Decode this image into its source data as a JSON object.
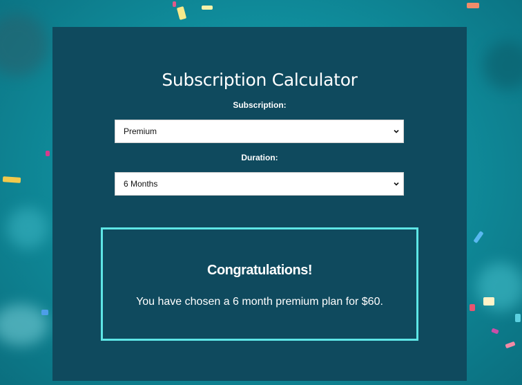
{
  "calculator": {
    "title": "Subscription Calculator",
    "subscription_label": "Subscription:",
    "subscription_value": "Premium",
    "duration_label": "Duration:",
    "duration_value": "6 Months"
  },
  "result": {
    "heading": "Congratulations!",
    "message": "You have chosen a 6 month premium plan for $60."
  },
  "colors": {
    "panel_bg": "#0f4a5e",
    "result_border": "#5ee6e6",
    "page_bg": "#1198a8"
  },
  "icons": {
    "dropdown": "chevron-down-icon"
  }
}
